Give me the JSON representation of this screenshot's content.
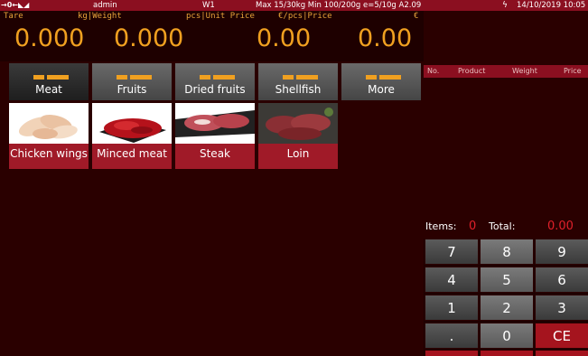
{
  "status": {
    "icons": "→0←◣◢",
    "user": "admin",
    "scale": "W1",
    "capacity": "Max 15/30kg  Min 100/200g e=5/10g A2.09",
    "power": "ϟ",
    "datetime": "14/10/2019 10:05"
  },
  "display": {
    "tare_label": "Tare",
    "tare_value": "0.000",
    "weight_label": "kg|Weight",
    "weight_value": "0.000",
    "unit_price_label": "pcs|Unit Price",
    "unit_price_value": "0.00",
    "price_label": "€/pcs|Price",
    "price_currency": "€",
    "price_value": "0.00"
  },
  "categories": [
    {
      "label": "Meat",
      "active": true
    },
    {
      "label": "Fruits",
      "active": false
    },
    {
      "label": "Dried fruits",
      "active": false
    },
    {
      "label": "Shellfish",
      "active": false
    },
    {
      "label": "More",
      "active": false
    }
  ],
  "products": [
    {
      "label": "Chicken wings",
      "icon": "chicken-wings-image"
    },
    {
      "label": "Minced meat",
      "icon": "minced-meat-image"
    },
    {
      "label": "Steak",
      "icon": "steak-image"
    },
    {
      "label": "Loin",
      "icon": "loin-image"
    }
  ],
  "ticket": {
    "columns": [
      "No.",
      "Product",
      "Weight",
      "Price"
    ],
    "items_label": "Items:",
    "items_value": "0",
    "total_label": "Total:",
    "total_value": "0.00"
  },
  "keypad": [
    "7",
    "8",
    "9",
    "4",
    "5",
    "6",
    "1",
    "2",
    "3",
    ".",
    "0",
    "CE"
  ],
  "colors": {
    "background": "#2a0000",
    "status_bar": "#8b0f20",
    "display_digits": "#f0a020",
    "accent_red": "#e0202a",
    "product_label_bg": "#a01a28"
  }
}
